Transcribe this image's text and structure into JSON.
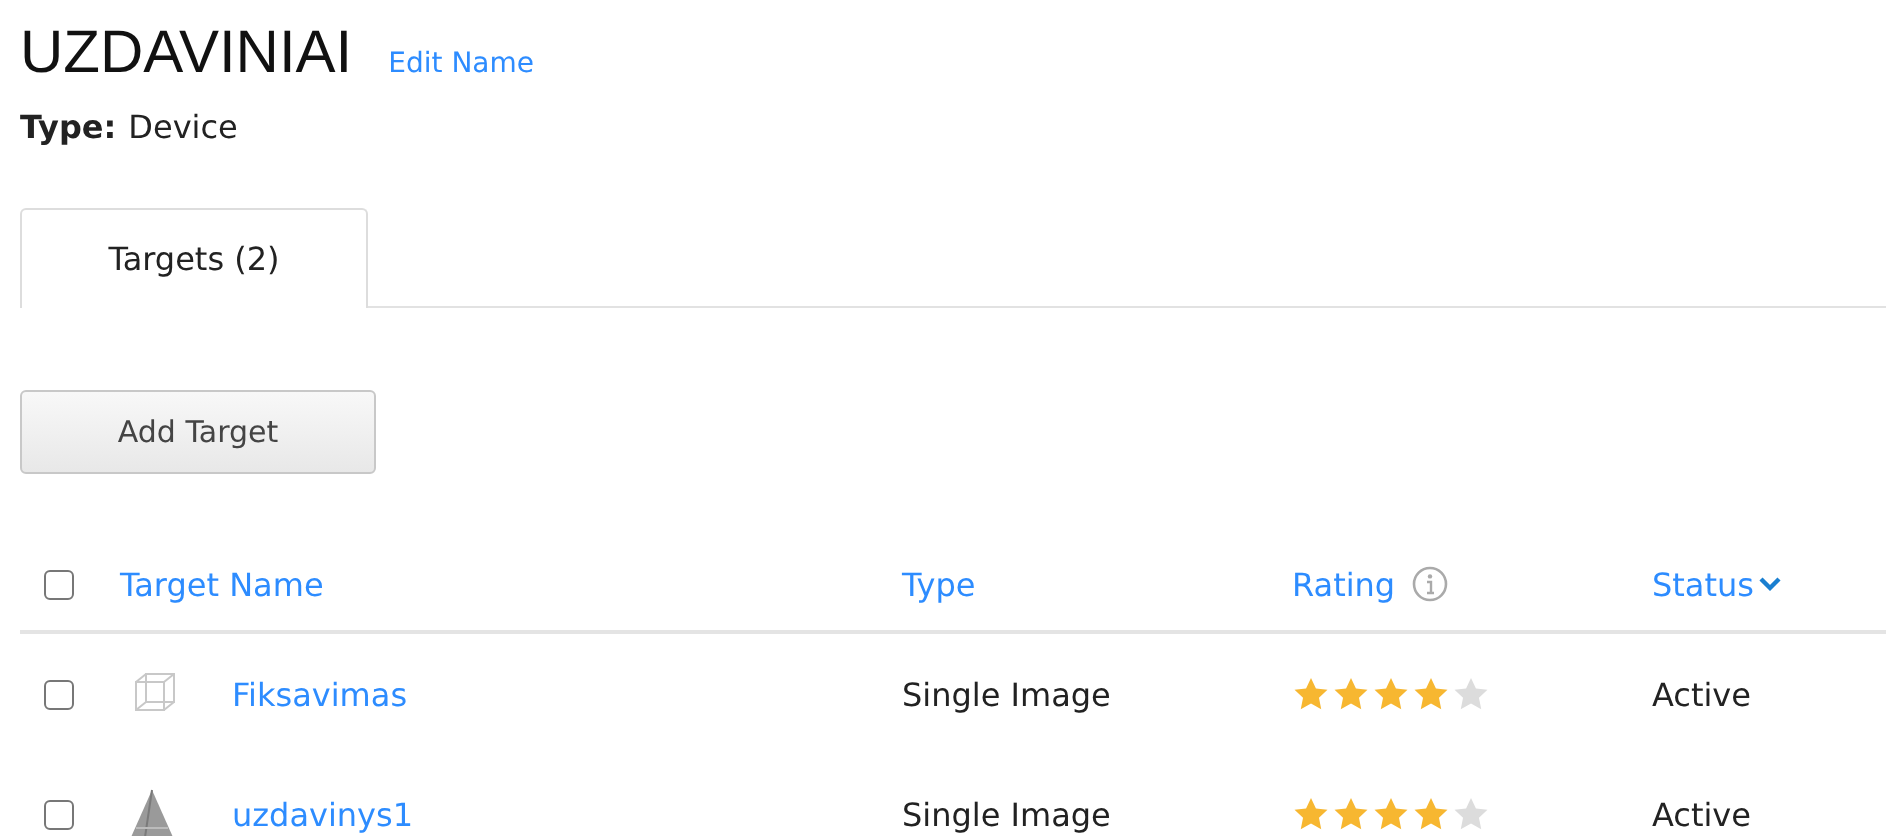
{
  "title": "UZDAVINIAI",
  "edit_link": "Edit Name",
  "type_label": "Type:",
  "type_value": "Device",
  "tabs": [
    {
      "label": "Targets (2)",
      "selected": true
    }
  ],
  "add_button": "Add Target",
  "table": {
    "select_all_checked": false,
    "columns": [
      {
        "label": "Target Name"
      },
      {
        "label": "Type"
      },
      {
        "label": "Rating",
        "kind": "info"
      },
      {
        "label": "Status",
        "kind": "sort"
      }
    ],
    "rows": [
      {
        "checked": false,
        "name": "Fiksavimas",
        "type": "Single Image",
        "stars": 4,
        "status": "Active"
      },
      {
        "checked": false,
        "name": "uzdavinys1",
        "type": "Single Image",
        "stars": 4,
        "status": "Active"
      }
    ]
  }
}
